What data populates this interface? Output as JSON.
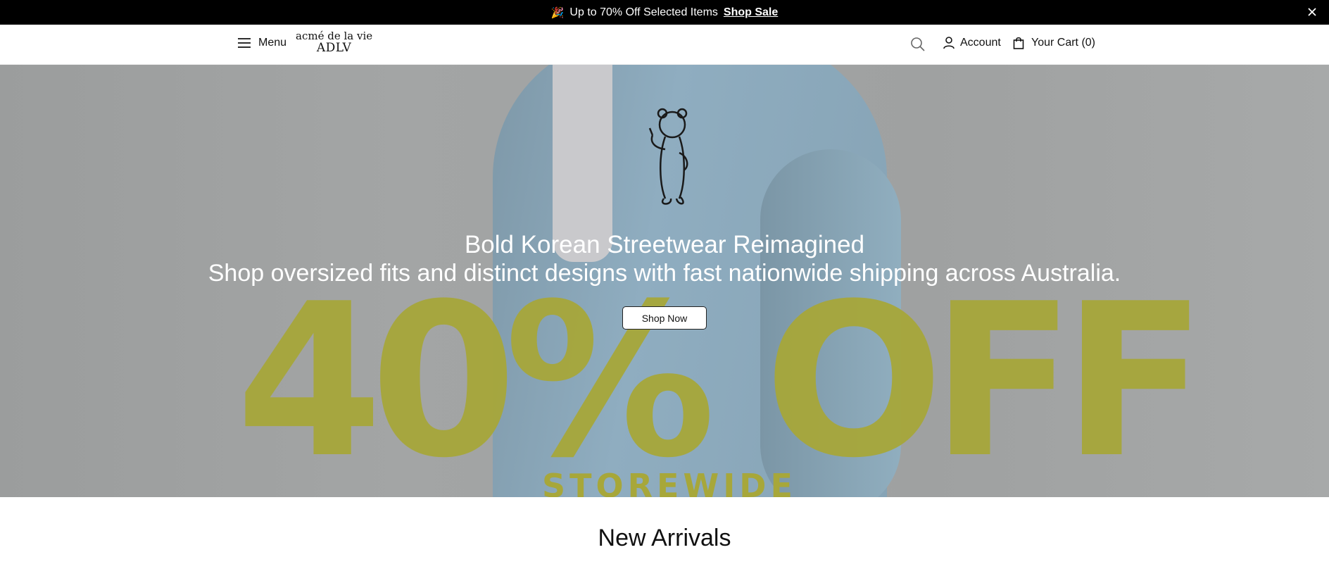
{
  "announcement": {
    "emoji": "🎉",
    "text": "Up to 70% Off Selected Items",
    "link_label": "Shop Sale"
  },
  "header": {
    "menu_label": "Menu",
    "logo_line1": "acmé de la vie",
    "logo_line2": "ADLV",
    "account_label": "Account",
    "cart_label": "Your Cart (0)"
  },
  "hero": {
    "title": "Bold Korean Streetwear Reimagined",
    "subtitle": "Shop oversized fits and distinct designs with fast nationwide shipping across Australia.",
    "button_label": "Shop Now",
    "promo_text": "40% OFF",
    "promo_subtext": "STOREWIDE"
  },
  "sections": {
    "new_arrivals_title": "New Arrivals"
  },
  "colors": {
    "announcement_bg": "#000000",
    "promo_yellow": "#a7a73a",
    "jacket_blue": "#8fadc0"
  }
}
